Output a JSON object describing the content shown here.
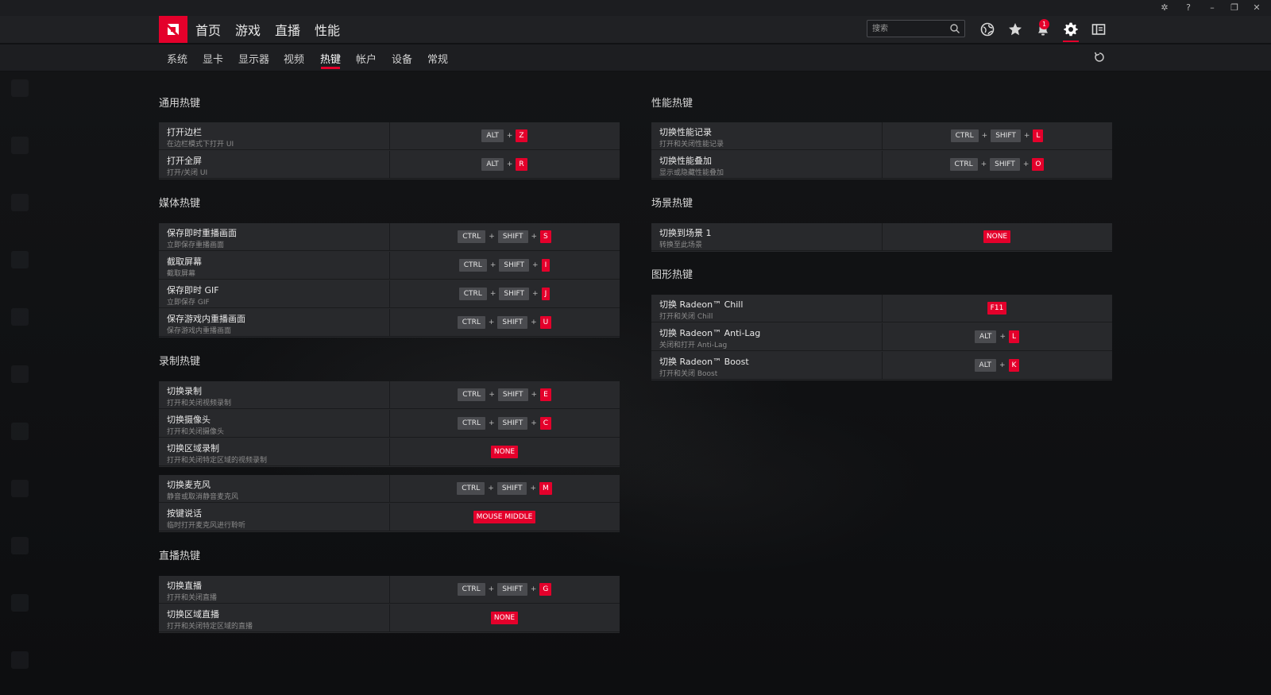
{
  "nav": {
    "items": [
      "首页",
      "游戏",
      "直播",
      "性能"
    ]
  },
  "search": {
    "placeholder": "搜索"
  },
  "notifications": {
    "count": "1"
  },
  "subnav": {
    "items": [
      "系统",
      "显卡",
      "显示器",
      "视频",
      "热键",
      "帐户",
      "设备",
      "常规"
    ],
    "active": "热键"
  },
  "colors": {
    "accent": "#e4002b",
    "panel": "#28292c",
    "key": "#4a4b4f"
  },
  "left": {
    "general": {
      "title": "通用热键",
      "rows": [
        {
          "name": "打开边栏",
          "desc": "在边栏模式下打开 UI",
          "mods": [
            "ALT"
          ],
          "key": "Z"
        },
        {
          "name": "打开全屏",
          "desc": "打开/关闭 UI",
          "mods": [
            "ALT"
          ],
          "key": "R"
        }
      ]
    },
    "media": {
      "title": "媒体热键",
      "rows": [
        {
          "name": "保存即时重播画面",
          "desc": "立即保存重播画面",
          "mods": [
            "CTRL",
            "SHIFT"
          ],
          "key": "S"
        },
        {
          "name": "截取屏幕",
          "desc": "截取屏幕",
          "mods": [
            "CTRL",
            "SHIFT"
          ],
          "key": "I"
        },
        {
          "name": "保存即时 GIF",
          "desc": "立即保存 GIF",
          "mods": [
            "CTRL",
            "SHIFT"
          ],
          "key": "J"
        },
        {
          "name": "保存游戏内重播画面",
          "desc": "保存游戏内重播画面",
          "mods": [
            "CTRL",
            "SHIFT"
          ],
          "key": "U"
        }
      ]
    },
    "record": {
      "title": "录制热键",
      "rows": [
        {
          "name": "切换录制",
          "desc": "打开和关闭视频录制",
          "mods": [
            "CTRL",
            "SHIFT"
          ],
          "key": "E"
        },
        {
          "name": "切换摄像头",
          "desc": "打开和关闭摄像头",
          "mods": [
            "CTRL",
            "SHIFT"
          ],
          "key": "C"
        },
        {
          "name": "切换区域录制",
          "desc": "打开和关闭特定区域的视频录制",
          "mods": [],
          "key": "NONE"
        }
      ]
    },
    "mic": {
      "rows": [
        {
          "name": "切换麦克风",
          "desc": "静音或取消静音麦克风",
          "mods": [
            "CTRL",
            "SHIFT"
          ],
          "key": "M"
        },
        {
          "name": "按键说话",
          "desc": "临时打开麦克风进行聆听",
          "mods": [],
          "key": "MOUSE MIDDLE"
        }
      ]
    },
    "stream": {
      "title": "直播热键",
      "rows": [
        {
          "name": "切换直播",
          "desc": "打开和关闭直播",
          "mods": [
            "CTRL",
            "SHIFT"
          ],
          "key": "G"
        },
        {
          "name": "切换区域直播",
          "desc": "打开和关闭特定区域的直播",
          "mods": [],
          "key": "NONE"
        }
      ]
    }
  },
  "right": {
    "perf": {
      "title": "性能热键",
      "rows": [
        {
          "name": "切换性能记录",
          "desc": "打开和关闭性能记录",
          "mods": [
            "CTRL",
            "SHIFT"
          ],
          "key": "L"
        },
        {
          "name": "切换性能叠加",
          "desc": "显示或隐藏性能叠加",
          "mods": [
            "CTRL",
            "SHIFT"
          ],
          "key": "O"
        }
      ]
    },
    "scene": {
      "title": "场景热键",
      "rows": [
        {
          "name": "切换到场景 1",
          "desc": "转换至此场景",
          "mods": [],
          "key": "NONE"
        }
      ]
    },
    "graphics": {
      "title": "图形热键",
      "rows": [
        {
          "name": "切换 Radeon™ Chill",
          "desc": "打开和关闭 Chill",
          "mods": [],
          "key": "F11"
        },
        {
          "name": "切换 Radeon™ Anti-Lag",
          "desc": "关闭和打开 Anti-Lag",
          "mods": [
            "ALT"
          ],
          "key": "L"
        },
        {
          "name": "切换 Radeon™ Boost",
          "desc": "打开和关闭 Boost",
          "mods": [
            "ALT"
          ],
          "key": "K"
        }
      ]
    }
  }
}
